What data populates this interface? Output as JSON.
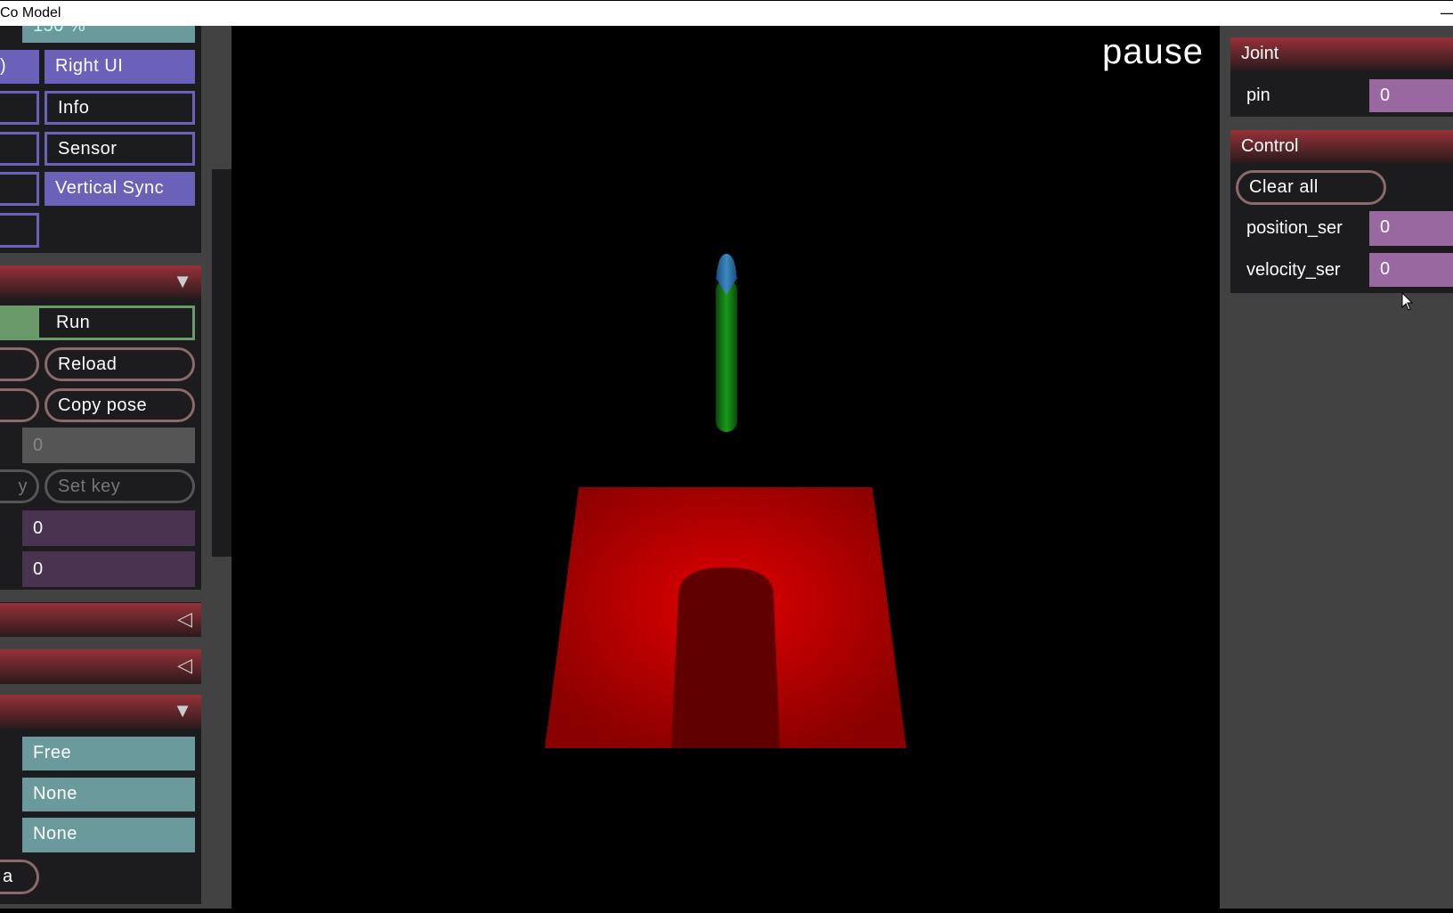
{
  "window": {
    "title": "Co Model"
  },
  "left_panel": {
    "zoom_value": "150 %",
    "row1_left": ")",
    "right_ui": "Right UI",
    "info": "Info",
    "sensor": "Sensor",
    "vertical_sync": "Vertical Sync",
    "run": "Run",
    "reload": "Reload",
    "copy_pose": "Copy pose",
    "key_value": "0",
    "set_key_left": "y",
    "set_key": "Set key",
    "value1": "0",
    "value2": "0",
    "camera": "Free",
    "label1": "None",
    "label2": "None",
    "bottom_left": "a"
  },
  "viewport": {
    "status": "pause"
  },
  "right_panel": {
    "joint": {
      "title": "Joint",
      "rows": [
        {
          "label": "pin",
          "value": "0"
        }
      ]
    },
    "control": {
      "title": "Control",
      "clear_all": "Clear all",
      "rows": [
        {
          "label": "position_ser",
          "value": "0"
        },
        {
          "label": "velocity_ser",
          "value": "0"
        }
      ]
    }
  },
  "colors": {
    "section_header": "#963238",
    "toggle_on": "#6a62b8",
    "select": "#6a9a9b",
    "slider": "#9a68a0",
    "floor": "#c00000"
  }
}
